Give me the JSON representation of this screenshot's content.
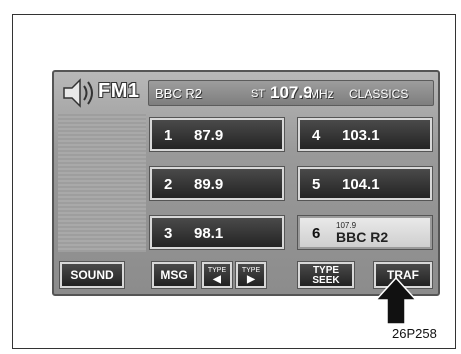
{
  "header": {
    "band": "FM1"
  },
  "status": {
    "station": "BBC R2",
    "stereo": "ST",
    "frequency": "107.9",
    "unit": "MHz",
    "genre": "CLASSICS"
  },
  "presets": [
    {
      "num": "1",
      "freq": "87.9"
    },
    {
      "num": "2",
      "freq": "89.9"
    },
    {
      "num": "3",
      "freq": "98.1"
    },
    {
      "num": "4",
      "freq": "103.1"
    },
    {
      "num": "5",
      "freq": "104.1"
    },
    {
      "num": "6",
      "small": "107.9",
      "name": "BBC R2"
    }
  ],
  "buttons": {
    "sound": "SOUND",
    "msg": "MSG",
    "type_label": "TYPE",
    "type_left": "◀",
    "type_right": "▶",
    "seek_line1": "TYPE",
    "seek_line2": "SEEK",
    "traf": "TRAF"
  },
  "figure_code": "26P258",
  "icons": {
    "speaker": "speaker-icon",
    "pointer": "up-arrow-icon"
  }
}
